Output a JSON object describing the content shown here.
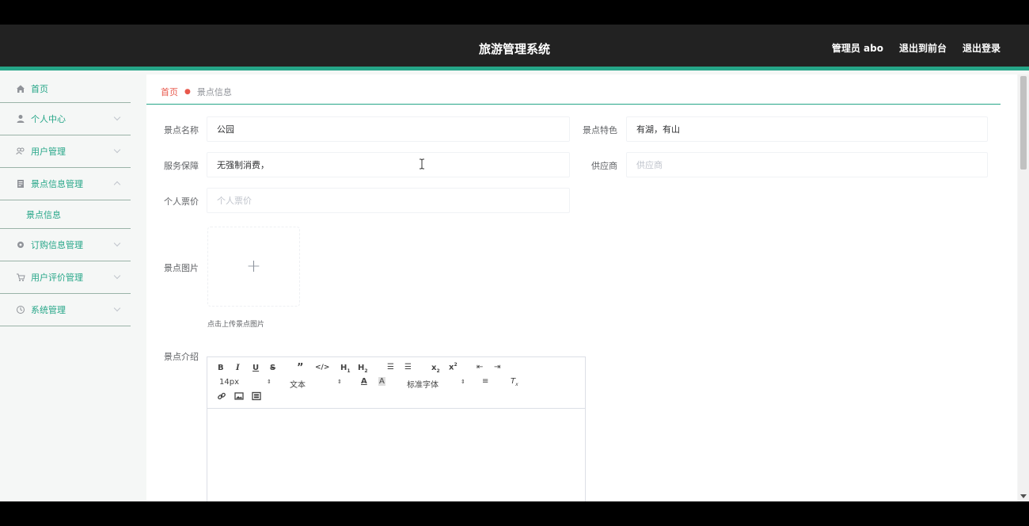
{
  "header": {
    "title": "旅游管理系统",
    "admin_label": "管理员 abo",
    "front_label": "退出到前台",
    "logout_label": "退出登录"
  },
  "sidebar": {
    "items": [
      {
        "label": "首页",
        "icon": "home-icon"
      },
      {
        "label": "个人中心",
        "icon": "user-icon"
      },
      {
        "label": "用户管理",
        "icon": "users-icon"
      },
      {
        "label": "景点信息管理",
        "icon": "document-icon"
      },
      {
        "label": "景点信息",
        "icon": ""
      },
      {
        "label": "订购信息管理",
        "icon": "gear-icon"
      },
      {
        "label": "用户评价管理",
        "icon": "cart-icon"
      },
      {
        "label": "系统管理",
        "icon": "settings-icon"
      }
    ]
  },
  "breadcrumb": {
    "home": "首页",
    "current": "景点信息"
  },
  "form": {
    "name_label": "景点名称",
    "name_value": "公园",
    "feature_label": "景点特色",
    "feature_value": "有湖，有山",
    "service_label": "服务保障",
    "service_value": "无强制消费，",
    "supplier_label": "供应商",
    "supplier_placeholder": "供应商",
    "price_label": "个人票价",
    "price_placeholder": "个人票价",
    "image_label": "景点图片",
    "upload_tip": "点击上传景点图片",
    "intro_label": "景点介绍"
  },
  "editor": {
    "font_size": "14px",
    "heading": "文本",
    "font_family": "标准字体"
  },
  "colors": {
    "accent": "#26a688",
    "header_bg": "#222222",
    "breadcrumb_home": "#e8584c"
  }
}
